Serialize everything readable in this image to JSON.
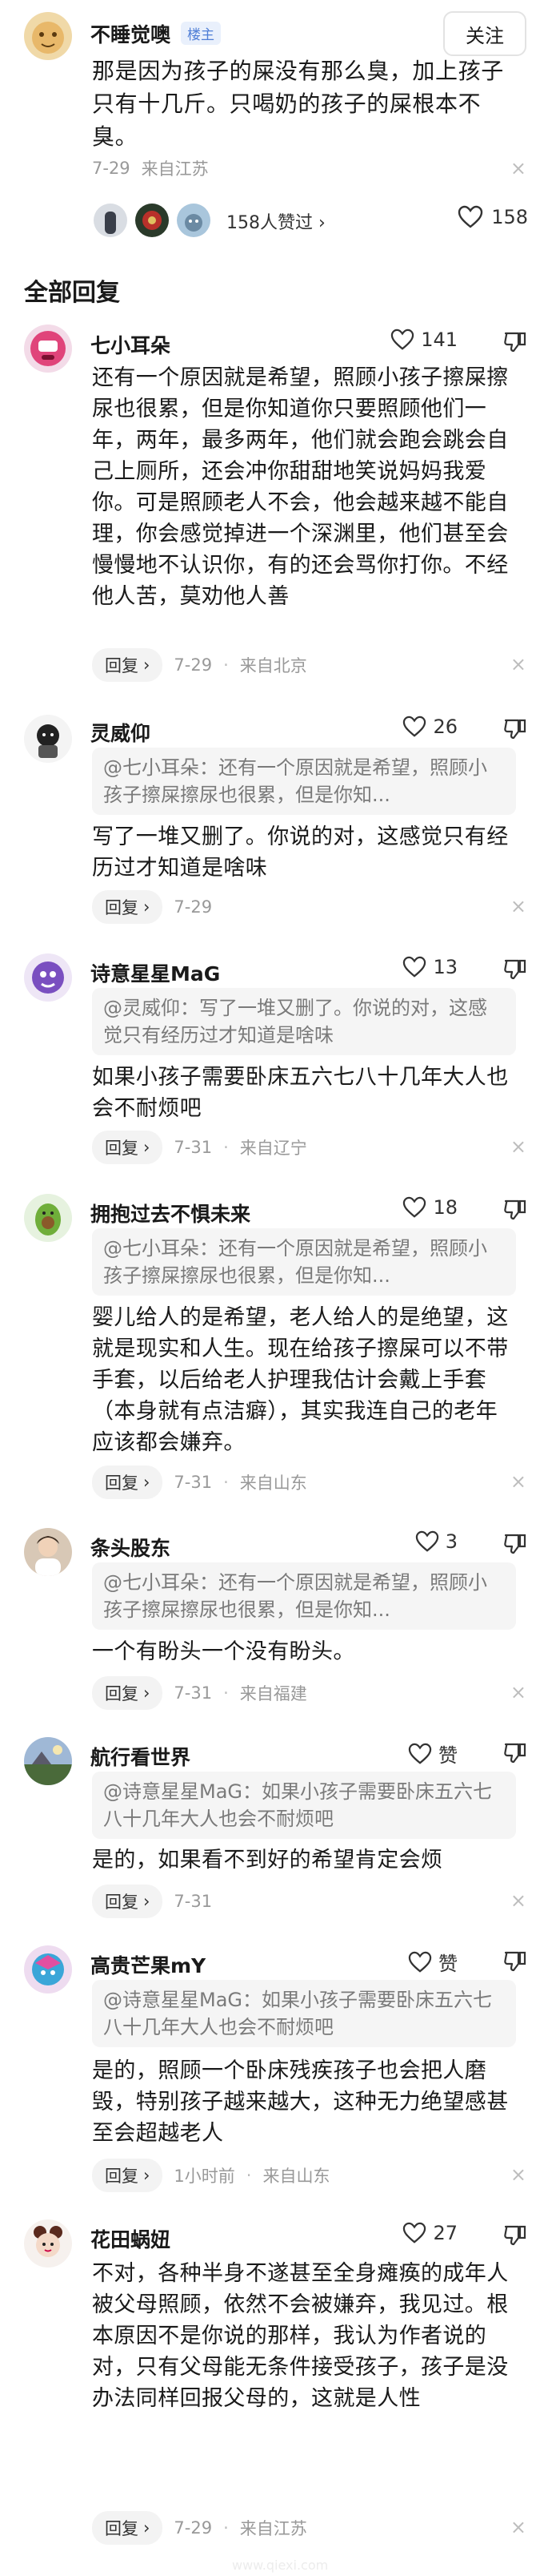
{
  "op": {
    "name": "不睡觉噢",
    "badge": "楼主",
    "follow_label": "关注",
    "text": "那是因为孩子的屎没有那么臭，加上孩子只有十几斤。只喝奶的孩子的屎根本不臭。",
    "time": "7-29",
    "location": "来自江苏",
    "close": "×",
    "likers_text": "158人赞过 ›",
    "like_count": "158"
  },
  "section_title": "全部回复",
  "reply_label": "回复",
  "reply_arrow": "›",
  "comments": [
    {
      "name": "七小耳朵",
      "likes": "141",
      "quote": "",
      "text": "还有一个原因就是希望，照顾小孩子擦屎擦尿也很累，但是你知道你只要照顾他们一年，两年，最多两年，他们就会跑会跳会自己上厕所，还会冲你甜甜地笑说妈妈我爱你。可是照顾老人不会，他会越来越不能自理，你会感觉掉进一个深渊里，他们甚至会慢慢地不认识你，有的还会骂你打你。不经他人苦，莫劝他人善",
      "time": "7-29",
      "location": "来自北京",
      "close": "×"
    },
    {
      "name": "灵威仰",
      "likes": "26",
      "quote": "@七小耳朵：还有一个原因就是希望，照顾小孩子擦屎擦尿也很累，但是你知...",
      "text": "写了一堆又删了。你说的对，这感觉只有经历过才知道是啥味",
      "time": "7-29",
      "location": "",
      "close": "×"
    },
    {
      "name": "诗意星星MaG",
      "likes": "13",
      "quote": "@灵威仰：写了一堆又删了。你说的对，这感觉只有经历过才知道是啥味",
      "text": "如果小孩子需要卧床五六七八十几年大人也会不耐烦吧",
      "time": "7-31",
      "location": "来自辽宁",
      "close": "×"
    },
    {
      "name": "拥抱过去不惧未来",
      "likes": "18",
      "quote": "@七小耳朵：还有一个原因就是希望，照顾小孩子擦屎擦尿也很累，但是你知...",
      "text": "婴儿给人的是希望，老人给人的是绝望，这就是现实和人生。现在给孩子擦屎可以不带手套，以后给老人护理我估计会戴上手套（本身就有点洁癖），其实我连自己的老年应该都会嫌弃。",
      "time": "7-31",
      "location": "来自山东",
      "close": "×"
    },
    {
      "name": "条头股东",
      "likes": "3",
      "quote": "@七小耳朵：还有一个原因就是希望，照顾小孩子擦屎擦尿也很累，但是你知...",
      "text": "一个有盼头一个没有盼头。",
      "time": "7-31",
      "location": "来自福建",
      "close": "×"
    },
    {
      "name": "航行看世界",
      "likes": "赞",
      "quote": "@诗意星星MaG：如果小孩子需要卧床五六七八十几年大人也会不耐烦吧",
      "text": "是的，如果看不到好的希望肯定会烦",
      "time": "7-31",
      "location": "",
      "close": "×"
    },
    {
      "name": "高贵芒果mY",
      "likes": "赞",
      "quote": "@诗意星星MaG：如果小孩子需要卧床五六七八十几年大人也会不耐烦吧",
      "text": "是的，照顾一个卧床残疾孩子也会把人磨毁，特别孩子越来越大，这种无力绝望感甚至会超越老人",
      "time": "1小时前",
      "location": "来自山东",
      "close": "×"
    },
    {
      "name": "花田蜗妞",
      "likes": "27",
      "quote": "",
      "text": "不对，各种半身不遂甚至全身瘫痪的成年人被父母照顾，依然不会被嫌弃，我见过。根本原因不是你说的那样，我认为作者说的对，只有父母能无条件接受孩子，孩子是没办法同样回报父母的，这就是人性",
      "time": "7-29",
      "location": "来自江苏",
      "close": "×"
    }
  ],
  "colors": {
    "accent": "#4f7ed6",
    "quote_bg": "#f5f5f5",
    "meta": "#999999"
  },
  "watermark": "www.qiexi.com"
}
